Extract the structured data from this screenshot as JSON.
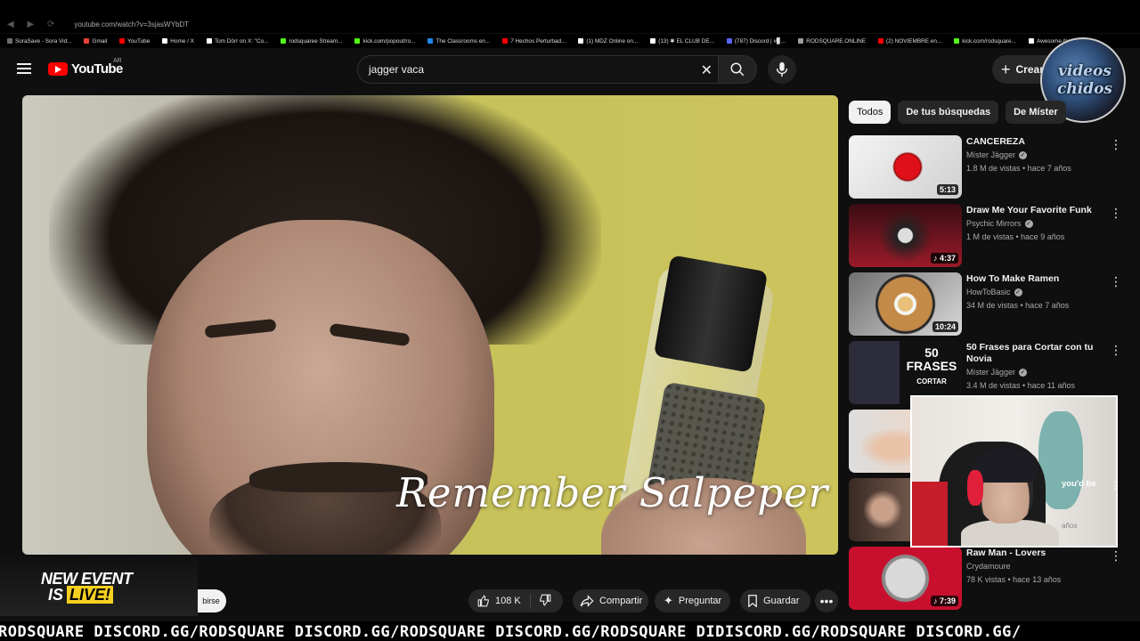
{
  "browser": {
    "url": "youtube.com/watch?v=3sjasWYbDT",
    "bookmarks": [
      {
        "label": "SoraSave - Sora Vid...",
        "color": "#6b6b6b"
      },
      {
        "label": "Gmail",
        "color": "#ea4335"
      },
      {
        "label": "YouTube",
        "color": "#ff0000"
      },
      {
        "label": "Home / X",
        "color": "#ffffff"
      },
      {
        "label": "Tom Dörr on X: \"Co...",
        "color": "#ffffff"
      },
      {
        "label": "rodsquaree Stream...",
        "color": "#53fc18"
      },
      {
        "label": "kick.com/popout/ro...",
        "color": "#53fc18"
      },
      {
        "label": "The Classrooms en...",
        "color": "#1e88e5"
      },
      {
        "label": "7 Hechos Perturbad...",
        "color": "#ff0000"
      },
      {
        "label": "(1) MDZ Online on...",
        "color": "#ffffff"
      },
      {
        "label": "(13) ✱ EL CLUB DE...",
        "color": "#ffffff"
      },
      {
        "label": "(787) Discord | #▊...",
        "color": "#5865f2"
      },
      {
        "label": "RODSQUARE.ONLINE",
        "color": "#9e9e9e"
      },
      {
        "label": "(2) NOVIEMBRE en...",
        "color": "#ff0000"
      },
      {
        "label": "kick.com/rodsquare...",
        "color": "#53fc18"
      },
      {
        "label": "Awesome-Nano-Ba...",
        "color": "#ffffff"
      }
    ]
  },
  "header": {
    "logo_text": "YouTube",
    "region": "AR",
    "search_value": "jagger vaca",
    "create_label": "Crear"
  },
  "channel_logo": {
    "line1": "videos",
    "line2": "chidos"
  },
  "player": {
    "caption": "Remember Salpeper"
  },
  "actions": {
    "subscribe_label": "birse",
    "likes": "108 K",
    "share": "Compartir",
    "ask": "Preguntar",
    "save": "Guardar"
  },
  "event_banner": {
    "line1": "NEW EVENT",
    "line2_prefix": "IS",
    "line2_live": "LIVE!"
  },
  "chips": [
    "Todos",
    "De tus búsquedas",
    "De Míster"
  ],
  "related": [
    {
      "title": "CANCEREZA",
      "channel": "Míster Jägger",
      "verified": true,
      "meta": "1.8 M de vistas • hace 7 años",
      "duration": "5:13",
      "thumb": "cherry"
    },
    {
      "title": "Draw Me Your Favorite Funk",
      "channel": "Psychic Mirrors",
      "verified": true,
      "meta": "1 M de vistas • hace 9 años",
      "duration": "♪ 4:37",
      "thumb": "funk"
    },
    {
      "title": "How To Make Ramen",
      "channel": "HowToBasic",
      "verified": true,
      "meta": "34 M de vistas • hace 7 años",
      "duration": "10:24",
      "thumb": "ramen"
    },
    {
      "title": "50 Frases para Cortar con tu Novia",
      "channel": "Míster Jägger",
      "verified": true,
      "meta": "3.4 M de vistas • hace 11 años",
      "duration": "",
      "thumb": "frases"
    },
    {
      "title": "",
      "channel": "",
      "verified": false,
      "meta": "",
      "duration": "",
      "thumb": "skin"
    },
    {
      "title": "",
      "channel": "",
      "verified": false,
      "meta": "",
      "duration": "",
      "thumb": "people"
    },
    {
      "title": "Raw Man - Lovers",
      "channel": "Crydamoure",
      "verified": false,
      "meta": "78 K vistas • hace 13 años",
      "duration": "♪ 7:39",
      "thumb": "coin"
    }
  ],
  "webcam": {
    "overlay_text": "you'd be",
    "overlay_sub": "años"
  },
  "ticker": "RODSQUARE DISCORD.GG/RODSQUARE DISCORD.GG/RODSQUARE DISCORD.GG/RODSQUARE DIDISCORD.GG/RODSQUARE DISCORD.GG/"
}
